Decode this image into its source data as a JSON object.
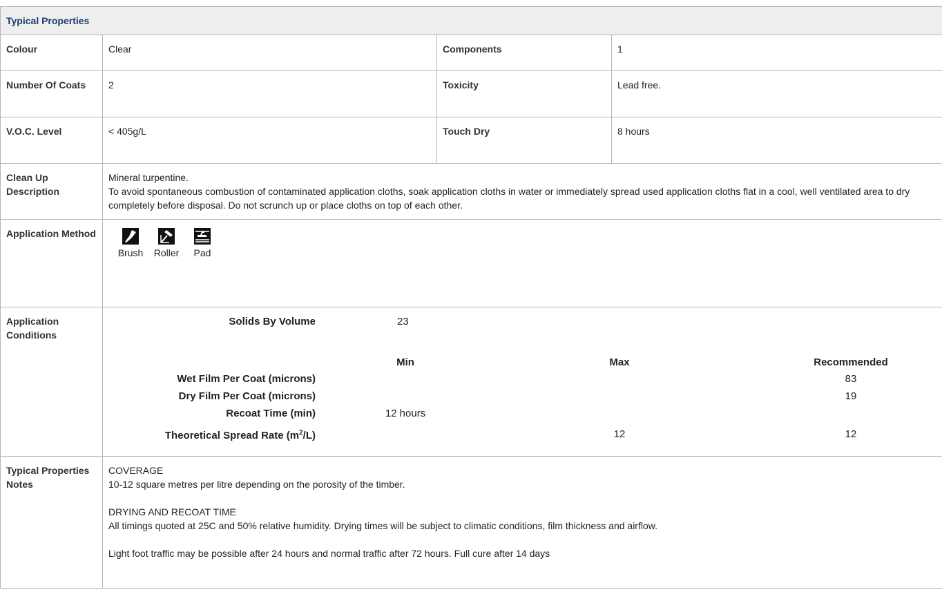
{
  "section_title": "Typical Properties",
  "rows": {
    "colour_label": "Colour",
    "colour_value": "Clear",
    "components_label": "Components",
    "components_value": "1",
    "coats_label": "Number Of Coats",
    "coats_value": "2",
    "toxicity_label": "Toxicity",
    "toxicity_value": "Lead free.",
    "voc_label": "V.O.C. Level",
    "voc_value": "< 405g/L",
    "touch_label": "Touch Dry",
    "touch_value": "8 hours",
    "cleanup_label": "Clean Up Description",
    "cleanup_line1": "Mineral turpentine.",
    "cleanup_line2": "To avoid spontaneous combustion of contaminated application cloths, soak application cloths in water or immediately spread used application cloths flat in a cool, well ventilated area to dry completely before disposal. Do not scrunch up or place cloths on top of each other.",
    "method_label": "Application Method"
  },
  "methods": [
    {
      "name": "Brush",
      "icon": "brush-icon"
    },
    {
      "name": "Roller",
      "icon": "roller-icon"
    },
    {
      "name": "Pad",
      "icon": "pad-icon"
    }
  ],
  "conditions": {
    "label": "Application Conditions",
    "solids_label": "Solids By Volume",
    "solids_value": "23",
    "col_min": "Min",
    "col_max": "Max",
    "col_rec": "Recommended",
    "wet_label": "Wet Film Per Coat (microns)",
    "wet_min": "",
    "wet_max": "",
    "wet_rec": "83",
    "dry_label": "Dry Film Per Coat (microns)",
    "dry_min": "",
    "dry_max": "",
    "dry_rec": "19",
    "recoat_label": "Recoat Time (min)",
    "recoat_min": "12 hours",
    "recoat_max": "",
    "recoat_rec": "",
    "spread_label_pre": "Theoretical Spread Rate (m",
    "spread_label_sup": "2",
    "spread_label_post": "/L)",
    "spread_min": "",
    "spread_max": "12",
    "spread_rec": "12"
  },
  "notes": {
    "label": "Typical Properties Notes",
    "coverage_head": "COVERAGE",
    "coverage_text": "10-12 square metres per litre depending on the porosity of the timber.",
    "drying_head": "DRYING AND RECOAT TIME",
    "drying_text": "All timings quoted at 25C and 50% relative humidity. Drying times will be subject to climatic conditions, film thickness and airflow.",
    "traffic_text": "Light foot traffic may be possible after 24 hours and normal traffic after 72 hours. Full cure after 14 days"
  }
}
